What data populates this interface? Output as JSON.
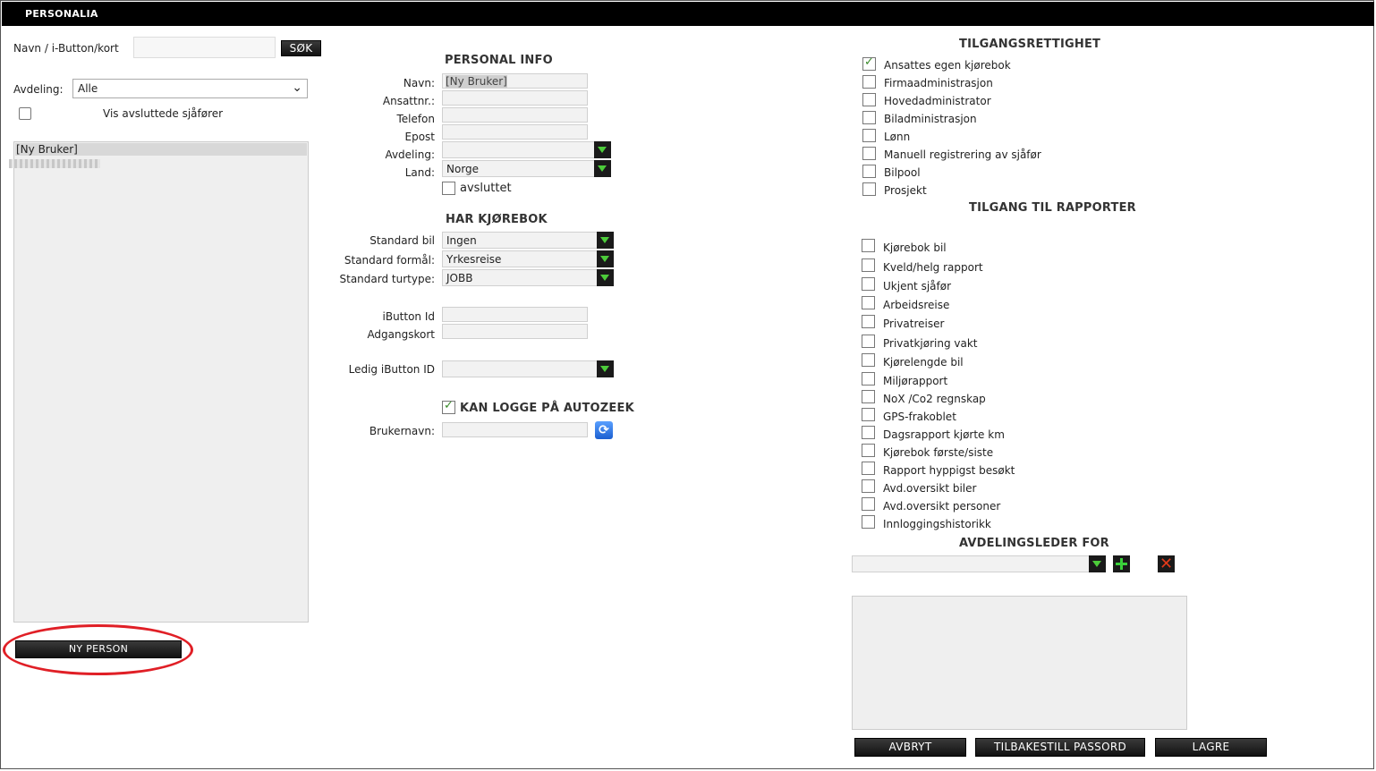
{
  "title": "PERSONALIA",
  "search": {
    "label": "Navn / i-Button/kort",
    "value": "",
    "button": "SØK"
  },
  "department_filter": {
    "label": "Avdeling:",
    "value": "Alle"
  },
  "show_ended": {
    "label": "Vis avsluttede sjåfører",
    "checked": false
  },
  "person_list": {
    "items": [
      "[Ny Bruker]"
    ]
  },
  "new_person_button": "NY PERSON",
  "personal_info": {
    "header": "PERSONAL INFO",
    "name_label": "Navn:",
    "name_value": "[Ny Bruker]",
    "empno_label": "Ansattnr.:",
    "phone_label": "Telefon",
    "email_label": "Epost",
    "dept_label": "Avdeling:",
    "dept_value": "",
    "country_label": "Land:",
    "country_value": "Norge",
    "ended_label": "avsluttet"
  },
  "logbook": {
    "header": "HAR KJØREBOK",
    "std_car_label": "Standard bil",
    "std_car_value": "Ingen",
    "std_purpose_label": "Standard formål:",
    "std_purpose_value": "Yrkesreise",
    "std_triptype_label": "Standard turtype:",
    "std_triptype_value": "JOBB",
    "ibutton_label": "iButton Id",
    "accesscard_label": "Adgangskort",
    "free_ibutton_label": "Ledig iButton ID",
    "free_ibutton_value": ""
  },
  "login": {
    "label": "KAN LOGGE PÅ AUTOZEEK",
    "checked": true,
    "username_label": "Brukernavn:"
  },
  "access_rights": {
    "header": "TILGANGSRETTIGHET",
    "items": [
      {
        "label": "Ansattes egen kjørebok",
        "checked": true
      },
      {
        "label": "Firmaadministrasjon",
        "checked": false
      },
      {
        "label": "Hovedadministrator",
        "checked": false
      },
      {
        "label": "Biladministrasjon",
        "checked": false
      },
      {
        "label": "Lønn",
        "checked": false
      },
      {
        "label": "Manuell registrering av sjåfør",
        "checked": false
      },
      {
        "label": "Bilpool",
        "checked": false
      },
      {
        "label": "Prosjekt",
        "checked": false
      }
    ]
  },
  "report_access": {
    "header": "TILGANG TIL RAPPORTER",
    "items": [
      {
        "label": "Kjørebok bil",
        "checked": false
      },
      {
        "label": "Kveld/helg rapport",
        "checked": false
      },
      {
        "label": "Ukjent sjåfør",
        "checked": false
      },
      {
        "label": "Arbeidsreise",
        "checked": false
      },
      {
        "label": "Privatreiser",
        "checked": false
      },
      {
        "label": "Privatkjøring vakt",
        "checked": false
      },
      {
        "label": "Kjørelengde bil",
        "checked": false
      },
      {
        "label": "Miljørapport",
        "checked": false
      },
      {
        "label": "NoX /Co2 regnskap",
        "checked": false
      },
      {
        "label": "GPS-frakoblet",
        "checked": false
      },
      {
        "label": "Dagsrapport kjørte km",
        "checked": false
      },
      {
        "label": "Kjørebok første/siste",
        "checked": false
      },
      {
        "label": "Rapport hyppigst besøkt",
        "checked": false
      },
      {
        "label": "Avd.oversikt biler",
        "checked": false
      },
      {
        "label": "Avd.oversikt personer",
        "checked": false
      },
      {
        "label": "Innloggingshistorikk",
        "checked": false
      }
    ]
  },
  "dept_manager": {
    "header": "AVDELINGSLEDER FOR",
    "value": ""
  },
  "footer": {
    "cancel": "AVBRYT",
    "reset_password": "TILBAKESTILL PASSORD",
    "save": "LAGRE"
  }
}
